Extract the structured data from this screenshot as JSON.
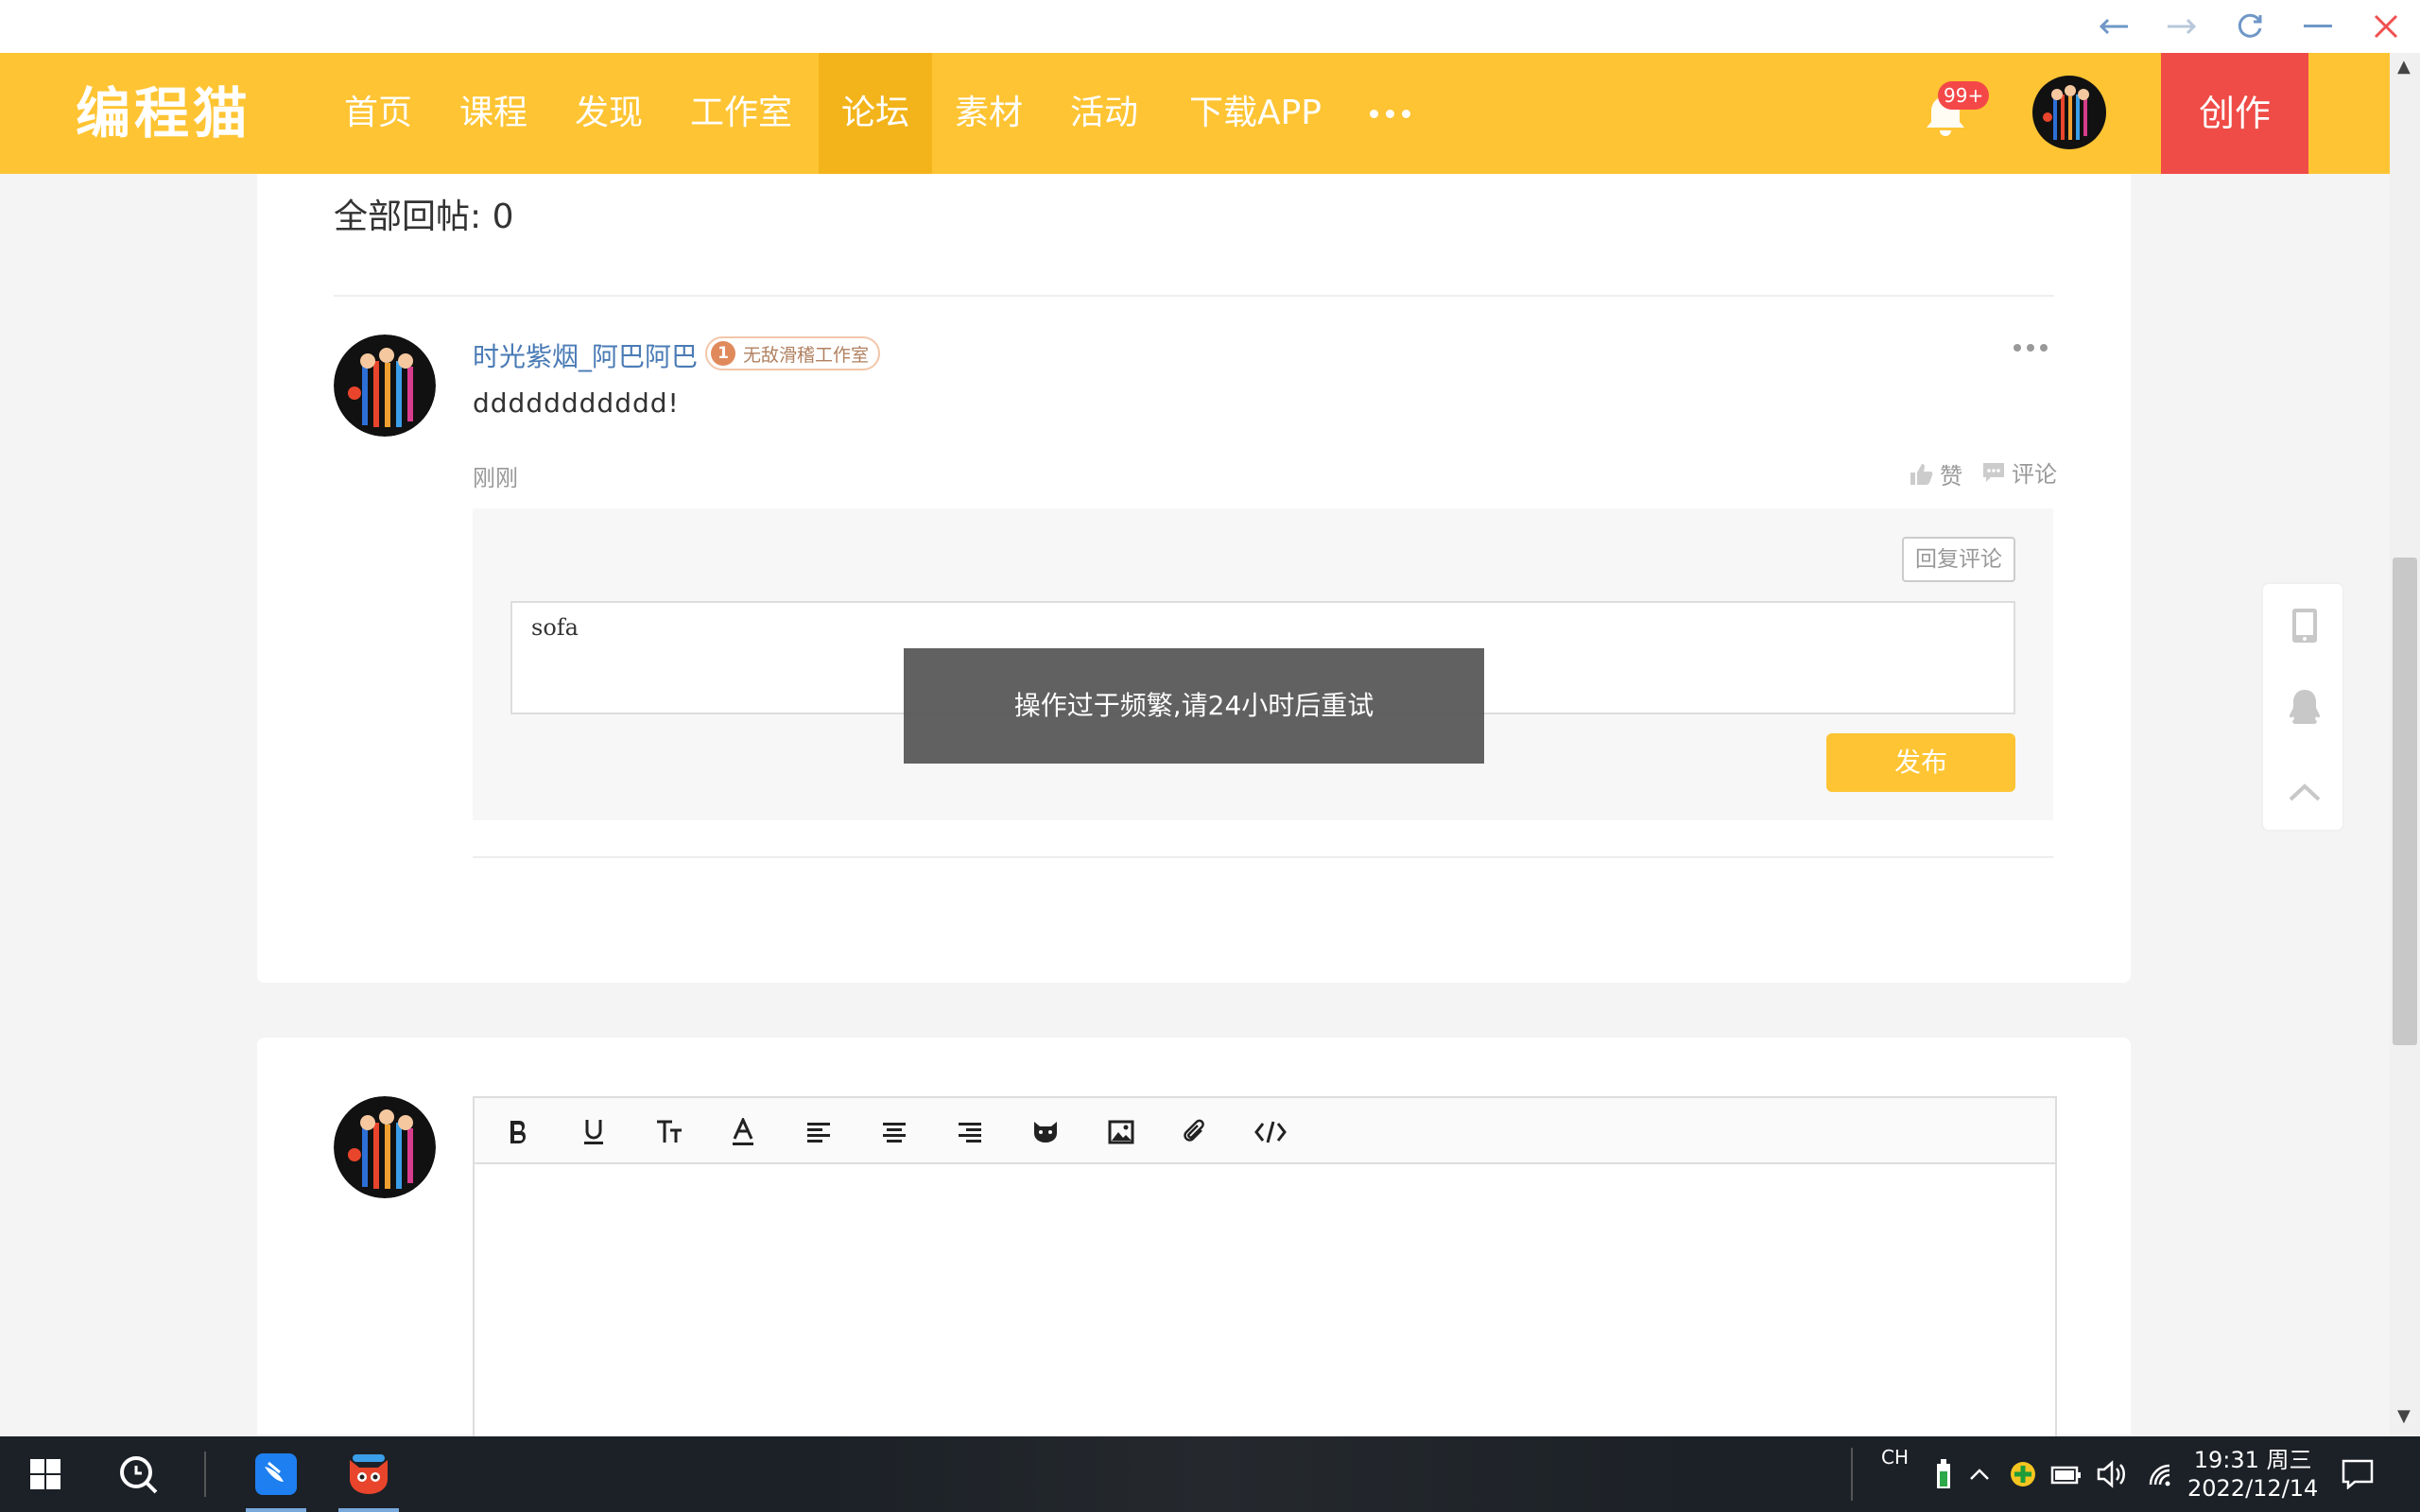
{
  "window": {
    "back": "back-arrow-icon",
    "forward": "forward-arrow-icon",
    "refresh": "refresh-icon",
    "minimize": "minimize-icon",
    "close": "close-icon"
  },
  "nav": {
    "logo": "编程猫",
    "items": [
      {
        "label": "首页"
      },
      {
        "label": "课程"
      },
      {
        "label": "发现"
      },
      {
        "label": "工作室"
      },
      {
        "label": "论坛",
        "active": true
      },
      {
        "label": "素材"
      },
      {
        "label": "活动"
      },
      {
        "label": "下载APP"
      }
    ],
    "notification_count": "99+",
    "create_label": "创作"
  },
  "thread": {
    "total_replies_label": "全部回帖: 0"
  },
  "post": {
    "username": "时光紫烟_阿巴阿巴",
    "studio_level": "1",
    "studio_name": "无敌滑稽工作室",
    "content": "ddddddddddd!",
    "time": "刚刚",
    "like_label": "赞",
    "comment_label": "评论",
    "reply_button": "回复评论",
    "reply_input_value": "sofa",
    "publish_button": "发布"
  },
  "toast": {
    "message": "操作过于频繁,请24小时后重试"
  },
  "editor": {
    "tools": [
      "bold-icon",
      "underline-icon",
      "font-size-icon",
      "font-color-icon",
      "align-left-icon",
      "align-center-icon",
      "align-right-icon",
      "emoji-cat-icon",
      "image-icon",
      "attachment-icon",
      "code-icon"
    ]
  },
  "taskbar": {
    "ime": "CH",
    "time": "19:31 周三",
    "date": "2022/12/14"
  },
  "colors": {
    "brand_yellow": "#fec433",
    "nav_active": "#f3b41b",
    "create_red": "#ef4b47",
    "link_blue": "#4a7bb5"
  }
}
